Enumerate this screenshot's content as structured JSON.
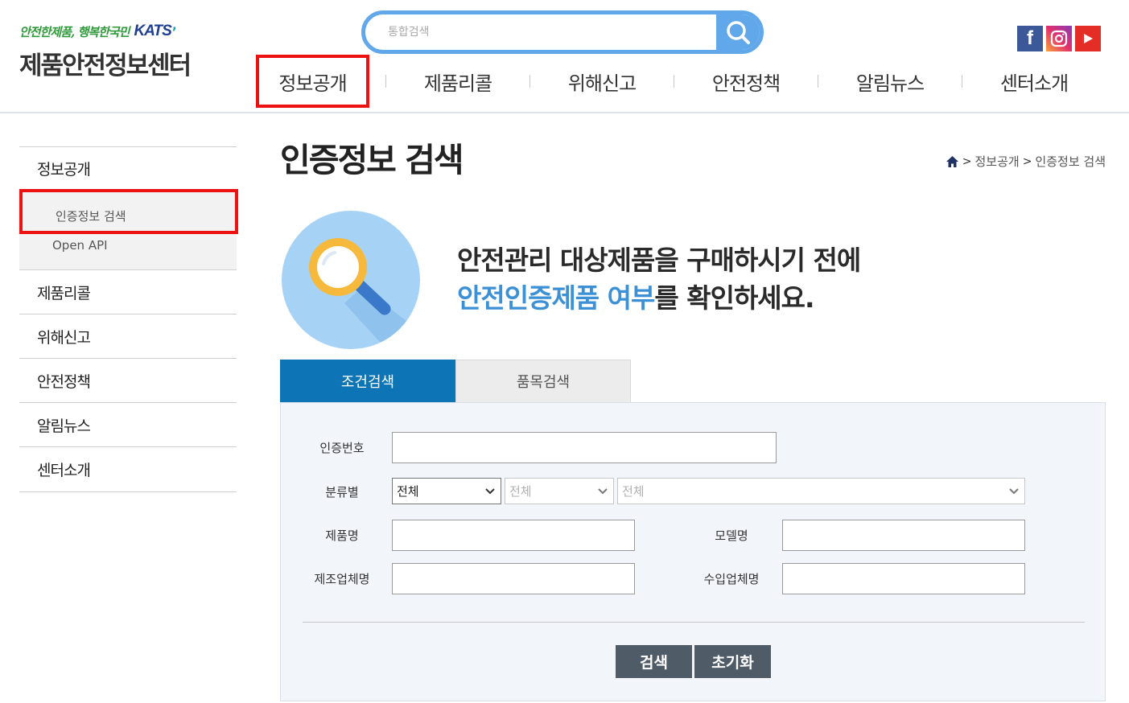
{
  "header": {
    "logo_slogan": "안전한제품, 행복한국민",
    "logo_brand": "KATS",
    "logo_title": "제품안전정보센터",
    "search_placeholder": "통합검색"
  },
  "gnb": {
    "items": [
      {
        "label": "정보공개"
      },
      {
        "label": "제품리콜"
      },
      {
        "label": "위해신고"
      },
      {
        "label": "안전정책"
      },
      {
        "label": "알림뉴스"
      },
      {
        "label": "센터소개"
      }
    ]
  },
  "sns": {
    "facebook_glyph": "f"
  },
  "sidebar": {
    "items": [
      {
        "label": "정보공개"
      },
      {
        "label": "제품리콜"
      },
      {
        "label": "위해신고"
      },
      {
        "label": "안전정책"
      },
      {
        "label": "알림뉴스"
      },
      {
        "label": "센터소개"
      }
    ],
    "sub_items": [
      {
        "label": "인증정보 검색"
      },
      {
        "label": "Open API"
      }
    ]
  },
  "main": {
    "title": "인증정보 검색",
    "breadcrumb": [
      "정보공개",
      "인증정보 검색"
    ],
    "hero_line1": "안전관리 대상제품을 구매하시기 전에",
    "hero_line2_highlight": "안전인증제품 여부",
    "hero_line2_rest": "를 확인하세요.",
    "tabs": [
      {
        "label": "조건검색"
      },
      {
        "label": "품목검색"
      }
    ]
  },
  "form": {
    "cert_no_label": "인증번호",
    "cert_no_value": "",
    "category_label": "분류별",
    "category_selects": [
      "전체",
      "전체",
      "전체"
    ],
    "product_label": "제품명",
    "product_value": "",
    "model_label": "모델명",
    "model_value": "",
    "maker_label": "제조업체명",
    "maker_value": "",
    "importer_label": "수입업체명",
    "importer_value": "",
    "search_button": "검색",
    "reset_button": "초기화"
  },
  "colors": {
    "accent_blue": "#0d74b5",
    "search_border": "#61a8ea",
    "highlight_red": "#ee1111",
    "button_dark": "#4f5b67"
  }
}
